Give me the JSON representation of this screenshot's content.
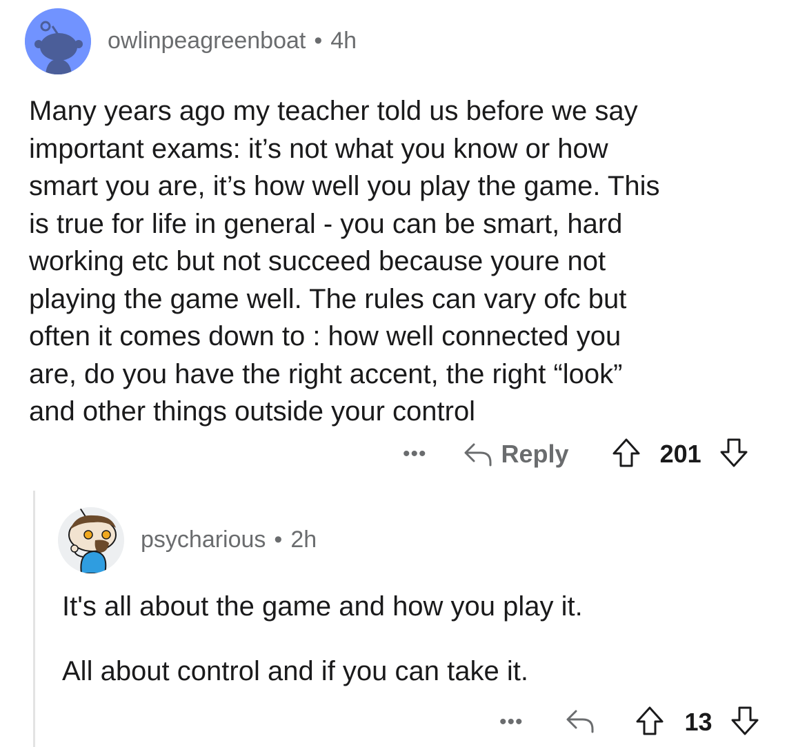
{
  "comment1": {
    "username": "owlinpeagreenboat",
    "separator": "•",
    "time": "4h",
    "lines": [
      "Many years ago my teacher told us before we say",
      "important exams: it’s not what you know or how",
      "smart you are, it’s how well you play the game. This",
      "is true for life in general - you can be smart, hard",
      "working etc but not succeed because youre not",
      "playing the game well. The rules can vary ofc but",
      "often it comes down to : how well connected you",
      "are, do you have the right accent, the right “look”",
      "and other things outside your control"
    ],
    "more": "•••",
    "reply_label": "Reply",
    "votes": "201",
    "icons": {
      "avatar": "snoo-avatar-icon",
      "more": "more-options-icon",
      "reply": "reply-arrow-icon",
      "upvote": "upvote-arrow-icon",
      "downvote": "downvote-arrow-icon"
    },
    "avatar_bg": "#7193ff"
  },
  "comment2": {
    "username": "psycharious",
    "separator": "•",
    "time": "2h",
    "paragraphs": [
      "It's all about the game and how you play it.",
      "All about control and if you can take it."
    ],
    "more": "•••",
    "votes": "13",
    "icons": {
      "avatar": "custom-snoo-avatar-icon",
      "more": "more-options-icon",
      "reply": "reply-arrow-icon",
      "upvote": "upvote-arrow-icon",
      "downvote": "downvote-arrow-icon"
    },
    "avatar_bg": "#edeff1"
  },
  "colors": {
    "meta_gray": "#6a6c6e",
    "text": "#1a1a1b",
    "thread_line": "#e3e3e3"
  }
}
